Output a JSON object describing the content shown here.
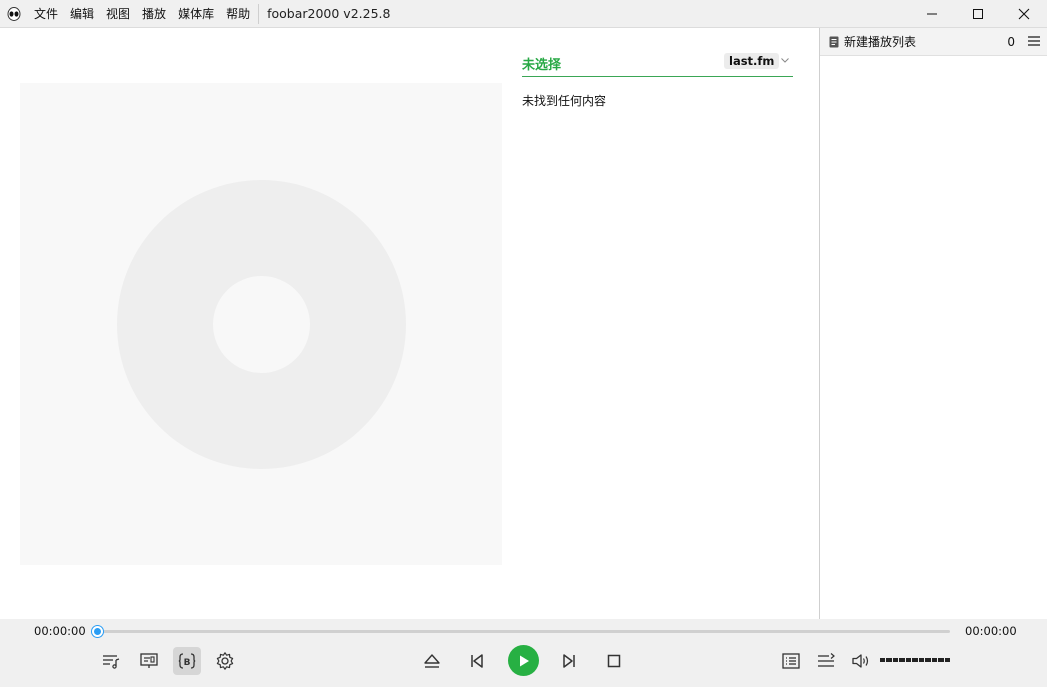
{
  "titlebar": {
    "menu": [
      "文件",
      "编辑",
      "视图",
      "播放",
      "媒体库",
      "帮助"
    ],
    "app_title": "foobar2000 v2.25.8"
  },
  "info_panel": {
    "title": "未选择",
    "source_label": "last.fm",
    "message": "未找到任何内容"
  },
  "playlist": {
    "name": "新建播放列表",
    "count": "0"
  },
  "transport": {
    "time_elapsed": "00:00:00",
    "time_total": "00:00:00",
    "position": 0,
    "volume": 1.0
  },
  "colors": {
    "accent_green": "#27a844",
    "play_button": "#27b043",
    "seek_knob": "#2a9df4"
  },
  "icons": {
    "app": "alien-head-icon",
    "left_controls": [
      "playlist-music-icon",
      "lyrics-card-icon",
      "bbcode-icon",
      "gear-icon"
    ],
    "center_controls": [
      "eject-icon",
      "previous-icon",
      "play-icon",
      "next-icon",
      "stop-icon"
    ],
    "right_controls": [
      "list-view-icon",
      "queue-icon",
      "speaker-icon"
    ]
  }
}
